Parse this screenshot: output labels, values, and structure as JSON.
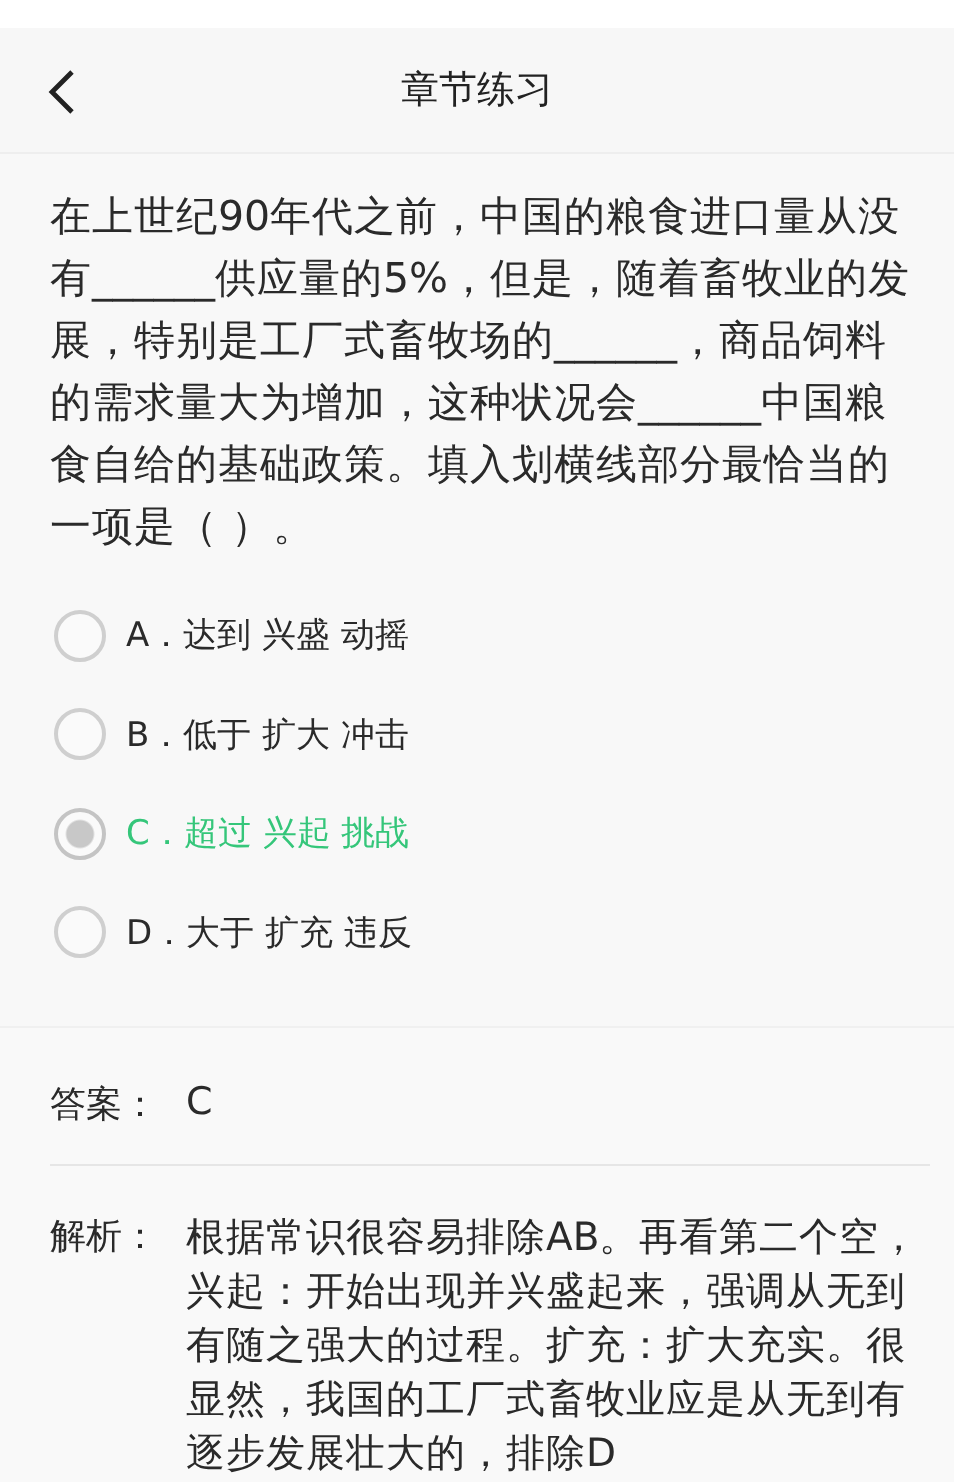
{
  "header": {
    "title": "章节练习"
  },
  "question": {
    "text": "在上世纪90年代之前，中国的粮食进口量从没有______供应量的5%，但是，随着畜牧业的发展，特别是工厂式畜牧场的______，商品饲料的需求量大为增加，这种状况会______中国粮食自给的基础政策。填入划横线部分最恰当的一项是（ ）。"
  },
  "options": [
    {
      "label": "A．达到 兴盛 动摇",
      "selected": false
    },
    {
      "label": "B．低于 扩大 冲击",
      "selected": false
    },
    {
      "label": "C．超过 兴起 挑战",
      "selected": true
    },
    {
      "label": "D．大于 扩充 违反",
      "selected": false
    }
  ],
  "answer": {
    "label": "答案：",
    "value": "C"
  },
  "analysis": {
    "label": "解析：",
    "text": "根据常识很容易排除AB。再看第二个空，兴起：开始出现并兴盛起来，强调从无到有随之强大的过程。扩充：扩大充实。很显然，我国的工厂式畜牧业应是从无到有逐步发展壮大的，排除D"
  }
}
